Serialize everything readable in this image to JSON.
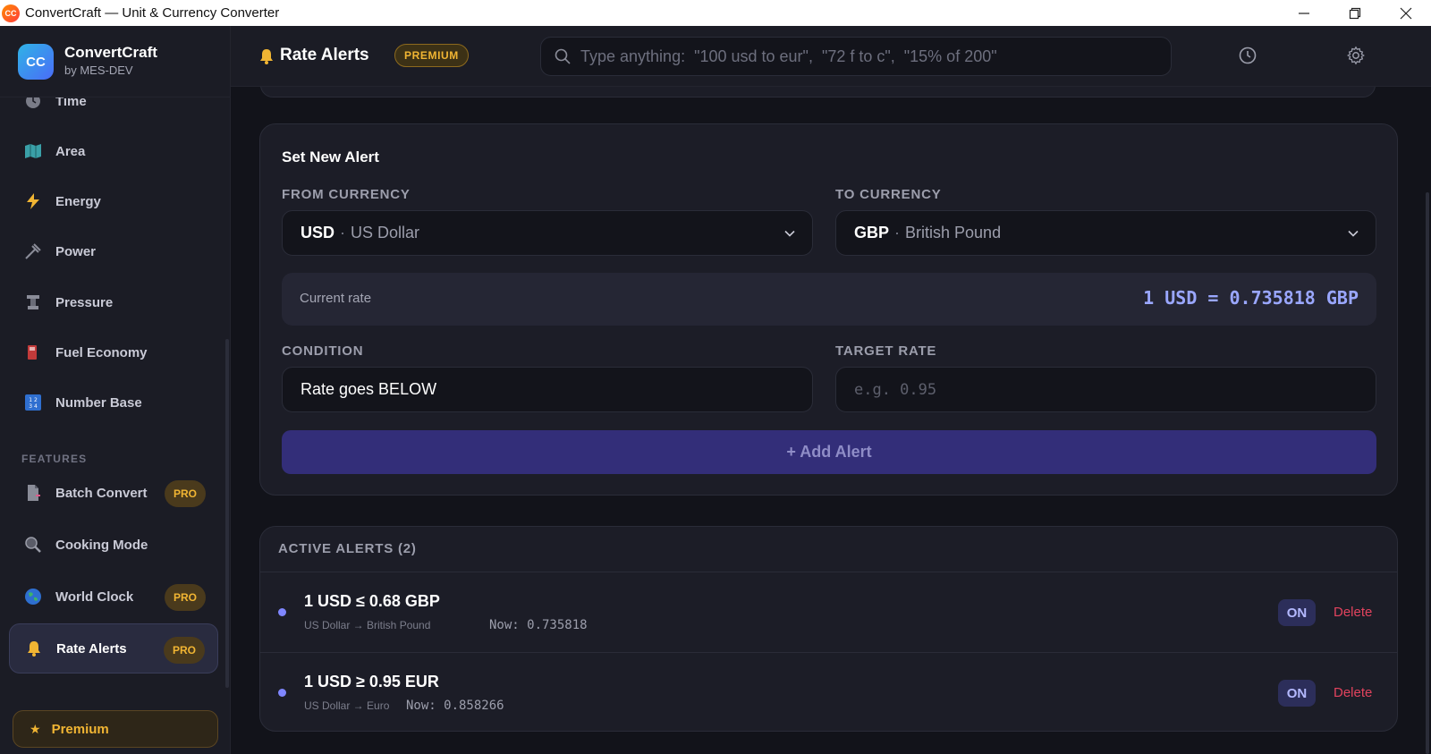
{
  "window": {
    "title": "ConvertCraft — Unit & Currency Converter",
    "app_icon_text": "CC"
  },
  "brand": {
    "logo_text": "CC",
    "name": "ConvertCraft",
    "subtitle": "by MES-DEV"
  },
  "sidebar": {
    "items": [
      {
        "label": "Time",
        "icon": "clock-icon"
      },
      {
        "label": "Area",
        "icon": "map-icon"
      },
      {
        "label": "Energy",
        "icon": "lightning-icon"
      },
      {
        "label": "Power",
        "icon": "plug-icon"
      },
      {
        "label": "Pressure",
        "icon": "gauge-icon"
      },
      {
        "label": "Fuel Economy",
        "icon": "fuel-pump-icon"
      },
      {
        "label": "Number Base",
        "icon": "numbers-icon"
      }
    ],
    "features_label": "FEATURES",
    "features": [
      {
        "label": "Batch Convert",
        "badge": "PRO",
        "icon": "document-icon"
      },
      {
        "label": "Cooking Mode",
        "badge": "",
        "icon": "magnifier-icon"
      },
      {
        "label": "World Clock",
        "badge": "PRO",
        "icon": "globe-icon"
      },
      {
        "label": "Rate Alerts",
        "badge": "PRO",
        "icon": "bell-icon",
        "active": true
      }
    ],
    "premium_label": "Premium"
  },
  "header": {
    "title": "Rate Alerts",
    "badge": "PREMIUM",
    "search_placeholder": "Type anything:  \"100 usd to eur\",  \"72 f to c\",  \"15% of 200\""
  },
  "new_alert": {
    "title": "Set New Alert",
    "from_label": "FROM CURRENCY",
    "from_code": "USD",
    "from_name": "US Dollar",
    "to_label": "TO CURRENCY",
    "to_code": "GBP",
    "to_name": "British Pound",
    "separator": "·",
    "current_rate_label": "Current rate",
    "current_rate_value": "1 USD = 0.735818 GBP",
    "condition_label": "CONDITION",
    "condition_value": "Rate goes BELOW",
    "target_label": "TARGET RATE",
    "target_placeholder": "e.g. 0.95",
    "add_button": "+ Add Alert"
  },
  "active_alerts": {
    "heading": "ACTIVE ALERTS (2)",
    "items": [
      {
        "rule": "1 USD ≤ 0.68 GBP",
        "pair": "US Dollar → British Pound",
        "now": "Now: 0.735818",
        "status": "ON",
        "delete": "Delete"
      },
      {
        "rule": "1 USD ≥ 0.95 EUR",
        "pair": "US Dollar → Euro",
        "now": "Now: 0.858266",
        "status": "ON",
        "delete": "Delete"
      }
    ]
  },
  "colors": {
    "accent": "#7f86ff",
    "premium_gold": "#f1b533",
    "danger": "#e2435e",
    "background": "#12131a"
  }
}
